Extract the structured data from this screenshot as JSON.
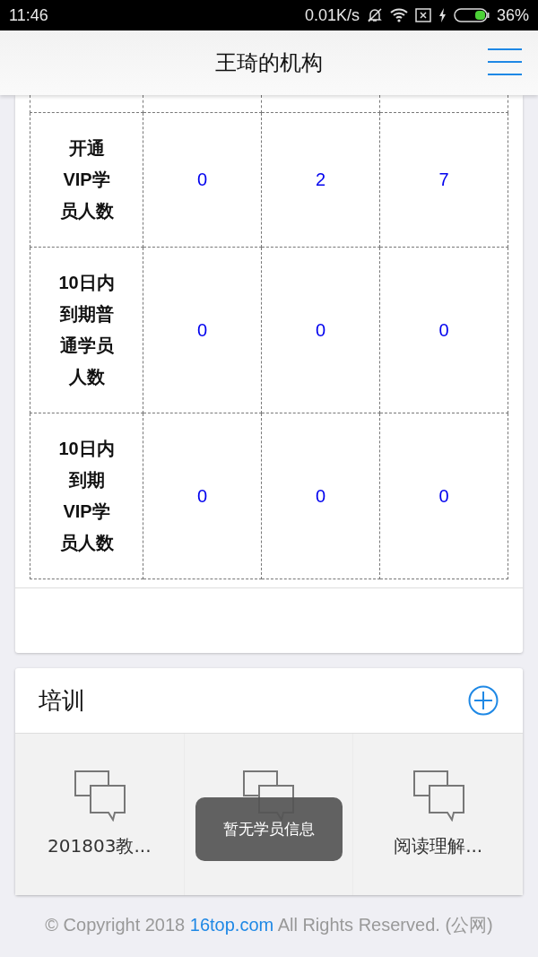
{
  "status_bar": {
    "time": "11:46",
    "network_speed": "0.01K/s",
    "battery": "36%"
  },
  "header": {
    "title": "王琦的机构"
  },
  "stats_table": {
    "rows": [
      {
        "label": "开通VIP学员人数",
        "values": [
          "0",
          "2",
          "7"
        ]
      },
      {
        "label": "10日内到期普通学员人数",
        "values": [
          "0",
          "0",
          "0"
        ]
      },
      {
        "label": "10日内到期VIP学员人数",
        "values": [
          "0",
          "0",
          "0"
        ]
      }
    ]
  },
  "training": {
    "title": "培训",
    "items": [
      {
        "kind": "labeled",
        "label": "201803教..."
      },
      {
        "kind": "covered"
      },
      {
        "kind": "labeled",
        "label": "阅读理解..."
      }
    ]
  },
  "toast": {
    "text": "暂无学员信息"
  },
  "footer": {
    "prefix": "© Copyright 2018 ",
    "link": "16top.com",
    "suffix": " All Rights Reserved. (公网)"
  }
}
